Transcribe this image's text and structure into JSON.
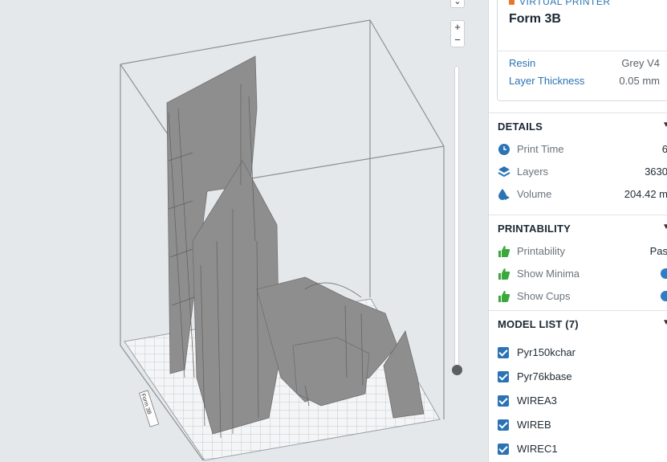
{
  "viewport": {
    "zoom_in": "+",
    "zoom_out": "−",
    "collapse_chevron": "⌄",
    "plate_label": "Form 3B"
  },
  "printer": {
    "tag": "VIRTUAL PRINTER",
    "name": "Form 3B",
    "resin_label": "Resin",
    "resin_value": "Grey V4",
    "layer_label": "Layer Thickness",
    "layer_value": "0.05 mm"
  },
  "details": {
    "title": "DETAILS",
    "print_time_label": "Print Time",
    "print_time_value": "6",
    "layers_label": "Layers",
    "layers_value": "3630",
    "volume_label": "Volume",
    "volume_value": "204.42 m"
  },
  "printability": {
    "title": "PRINTABILITY",
    "printability_label": "Printability",
    "printability_value": "Pas",
    "show_minima_label": "Show Minima",
    "show_cups_label": "Show Cups"
  },
  "model_list": {
    "title": "MODEL LIST (7)",
    "items": [
      "Pyr150kchar",
      "Pyr76kbase",
      "WIREA3",
      "WIREB",
      "WIREC1"
    ]
  },
  "colors": {
    "accent": "#2b73b5",
    "toggle_on": "#2e7dc7",
    "thumbs_up": "#3aa83c",
    "model_grey": "#8e8e8e"
  }
}
